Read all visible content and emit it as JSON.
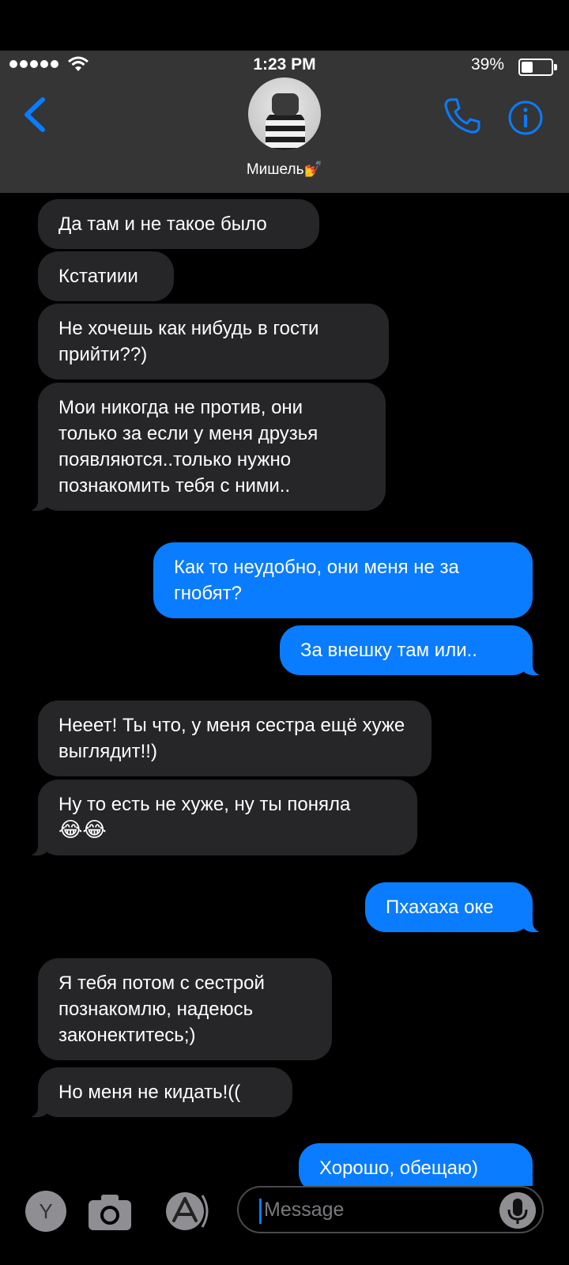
{
  "status_bar": {
    "time": "1:23 PM",
    "battery": "39%"
  },
  "header": {
    "contact_name": "Мишель💅"
  },
  "messages": [
    {
      "dir": "in",
      "text": "Да там и не такое было"
    },
    {
      "dir": "in",
      "text": "Кстатиии"
    },
    {
      "dir": "in",
      "text": "Не хочешь как нибудь в гости прийти??)"
    },
    {
      "dir": "in",
      "text": "Мои никогда не против, они только за если у меня друзья появляются..только нужно познакомить тебя с ними.."
    },
    {
      "dir": "out",
      "text": "Как то неудобно, они меня не за гнобят?"
    },
    {
      "dir": "out",
      "text": "За внешку там или.."
    },
    {
      "dir": "in",
      "text": "Нееет! Ты что, у меня сестра ещё хуже выглядит!!)"
    },
    {
      "dir": "in",
      "text": "Ну то есть не хуже, ну ты поняла",
      "emoji": "😂😂"
    },
    {
      "dir": "out",
      "text": "Пхахаха оке"
    },
    {
      "dir": "in",
      "text": "Я тебя потом с сестрой познакомлю, надеюсь законектитесь;)"
    },
    {
      "dir": "in",
      "text": "Но меня не кидать!(("
    },
    {
      "dir": "out",
      "text": "Хорошо, обещаю)"
    }
  ],
  "composer": {
    "apps_button_label": "Y",
    "placeholder": "Message"
  },
  "icons": {
    "back": "chevron-left-icon",
    "call": "phone-icon",
    "info": "info-icon",
    "camera": "camera-icon",
    "appstore": "app-store-icon",
    "mic": "microphone-icon"
  },
  "colors": {
    "outgoing": "#0a7cff",
    "incoming": "#262629",
    "header": "#353535",
    "accent": "#0a7cff"
  }
}
